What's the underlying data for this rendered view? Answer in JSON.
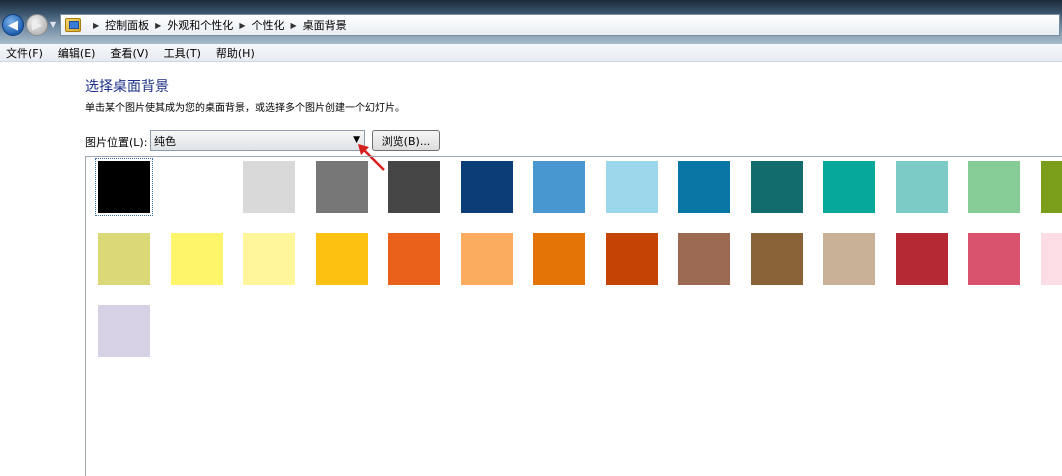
{
  "addressbar": {
    "breadcrumbs": [
      "控制面板",
      "外观和个性化",
      "个性化",
      "桌面背景"
    ]
  },
  "menu": {
    "items": [
      "文件(F)",
      "编辑(E)",
      "查看(V)",
      "工具(T)",
      "帮助(H)"
    ]
  },
  "page": {
    "title": "选择桌面背景",
    "subtitle": "单击某个图片使其成为您的桌面背景，或选择多个图片创建一个幻灯片。",
    "location_label": "图片位置(L):",
    "location_value": "纯色",
    "browse_label": "浏览(B)..."
  },
  "colors": {
    "title": "#1e3287",
    "annotation_arrow": "#d61f1f"
  },
  "swatches": [
    [
      "#000000",
      "#ffffff",
      "#d9d9d9",
      "#777777",
      "#454545",
      "#0c3d77",
      "#4997d0",
      "#9bd8eb",
      "#0877a6",
      "#126b6d",
      "#05a89a",
      "#7ccbc7",
      "#86cc97",
      "#7a9e1a"
    ],
    [
      "#dbd977",
      "#fff56b",
      "#fff59b",
      "#fdc112",
      "#ea611b",
      "#fcac5e",
      "#e57407",
      "#c44305",
      "#9c6a52",
      "#8a6237",
      "#c8b197",
      "#b52934",
      "#d9536f",
      "#fcdde5"
    ],
    [
      "#d6d1e5"
    ]
  ],
  "selected_swatch": "#000000"
}
